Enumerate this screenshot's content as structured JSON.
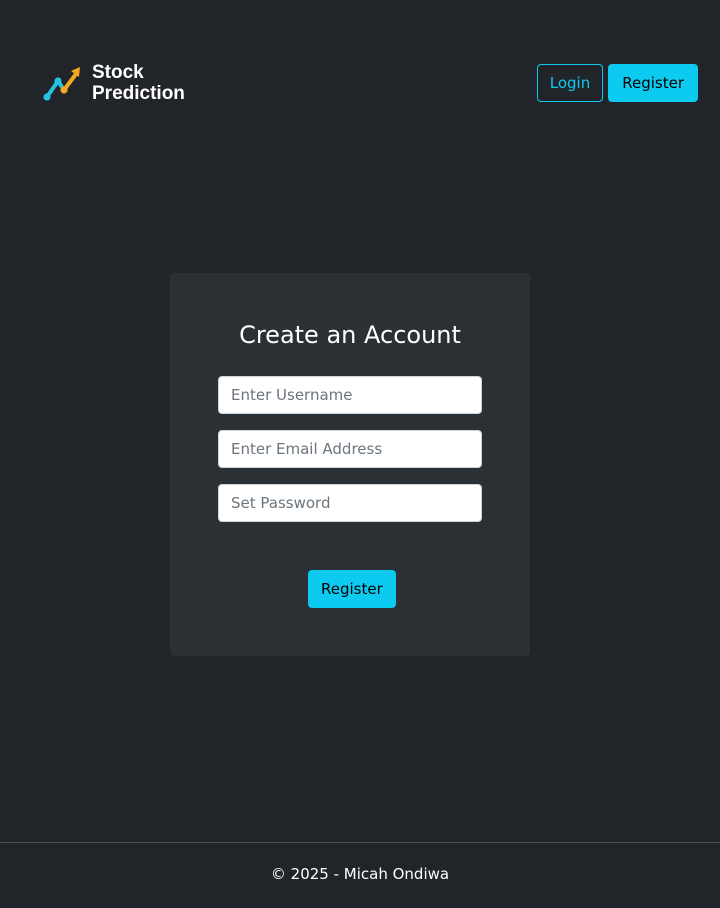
{
  "header": {
    "brand_line1": "Stock",
    "brand_line2": "Prediction",
    "logo_icon": "trend-up-icon",
    "nav": {
      "login_label": "Login",
      "register_label": "Register"
    }
  },
  "form": {
    "title": "Create an Account",
    "username": {
      "placeholder": "Enter Username",
      "value": ""
    },
    "email": {
      "placeholder": "Enter Email Address",
      "value": ""
    },
    "password": {
      "placeholder": "Set Password",
      "value": ""
    },
    "submit_label": "Register"
  },
  "footer": {
    "copyright": "© 2025 - Micah Ondiwa"
  },
  "colors": {
    "background": "#212529",
    "card": "#2b3035",
    "accent": "#0dcaf0",
    "logo_blue": "#25c2e0",
    "logo_orange": "#f5a623"
  }
}
